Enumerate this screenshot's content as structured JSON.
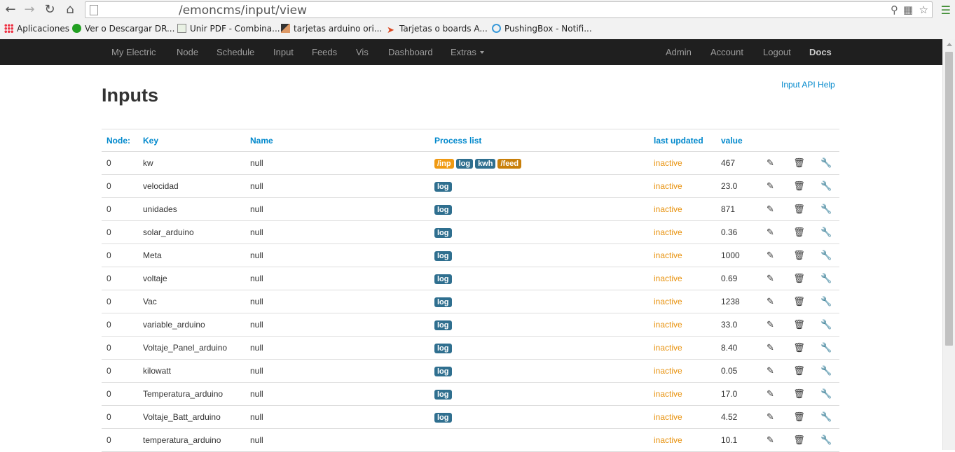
{
  "browser": {
    "url": "/emoncms/input/view",
    "bookmarks": [
      {
        "label": "Aplicaciones",
        "icon": "apps-icon"
      },
      {
        "label": "Ver o Descargar DR...",
        "icon": "green-dot-icon"
      },
      {
        "label": "Unir PDF - Combina...",
        "icon": "pdf-icon"
      },
      {
        "label": "tarjetas arduino ori...",
        "icon": "tools-icon"
      },
      {
        "label": "Tarjetas o boards A...",
        "icon": "arrow-icon"
      },
      {
        "label": "PushingBox - Notifi...",
        "icon": "pushingbox-icon"
      }
    ]
  },
  "navbar": {
    "left": [
      "My Electric",
      "Node",
      "Schedule",
      "Input",
      "Feeds",
      "Vis",
      "Dashboard",
      "Extras"
    ],
    "right": [
      "Admin",
      "Account",
      "Logout",
      "Docs"
    ]
  },
  "page": {
    "title": "Inputs",
    "help_link": "Input API Help"
  },
  "table": {
    "headers": [
      "Node:",
      "Key",
      "Name",
      "Process list",
      "last updated",
      "value"
    ],
    "rows": [
      {
        "node": "0",
        "key": "kw",
        "name": "null",
        "process": [
          "/inp",
          "log",
          "kwh",
          "/feed"
        ],
        "updated": "inactive",
        "value": "467"
      },
      {
        "node": "0",
        "key": "velocidad",
        "name": "null",
        "process": [
          "log"
        ],
        "updated": "inactive",
        "value": "23.0"
      },
      {
        "node": "0",
        "key": "unidades",
        "name": "null",
        "process": [
          "log"
        ],
        "updated": "inactive",
        "value": "871"
      },
      {
        "node": "0",
        "key": "solar_arduino",
        "name": "null",
        "process": [
          "log"
        ],
        "updated": "inactive",
        "value": "0.36"
      },
      {
        "node": "0",
        "key": "Meta",
        "name": "null",
        "process": [
          "log"
        ],
        "updated": "inactive",
        "value": "1000"
      },
      {
        "node": "0",
        "key": "voltaje",
        "name": "null",
        "process": [
          "log"
        ],
        "updated": "inactive",
        "value": "0.69"
      },
      {
        "node": "0",
        "key": "Vac",
        "name": "null",
        "process": [
          "log"
        ],
        "updated": "inactive",
        "value": "1238"
      },
      {
        "node": "0",
        "key": "variable_arduino",
        "name": "null",
        "process": [
          "log"
        ],
        "updated": "inactive",
        "value": "33.0"
      },
      {
        "node": "0",
        "key": "Voltaje_Panel_arduino",
        "name": "null",
        "process": [
          "log"
        ],
        "updated": "inactive",
        "value": "8.40"
      },
      {
        "node": "0",
        "key": "kilowatt",
        "name": "null",
        "process": [
          "log"
        ],
        "updated": "inactive",
        "value": "0.05"
      },
      {
        "node": "0",
        "key": "Temperatura_arduino",
        "name": "null",
        "process": [
          "log"
        ],
        "updated": "inactive",
        "value": "17.0"
      },
      {
        "node": "0",
        "key": "Voltaje_Batt_arduino",
        "name": "null",
        "process": [
          "log"
        ],
        "updated": "inactive",
        "value": "4.52"
      },
      {
        "node": "0",
        "key": "temperatura_arduino",
        "name": "null",
        "process": [],
        "updated": "inactive",
        "value": "10.1"
      }
    ]
  },
  "colors": {
    "accent": "#0088cc",
    "inactive": "#e8920e",
    "navbar_bg": "#1f1f1f",
    "label_info": "#2f6f8f",
    "label_warning": "#f09a13"
  }
}
